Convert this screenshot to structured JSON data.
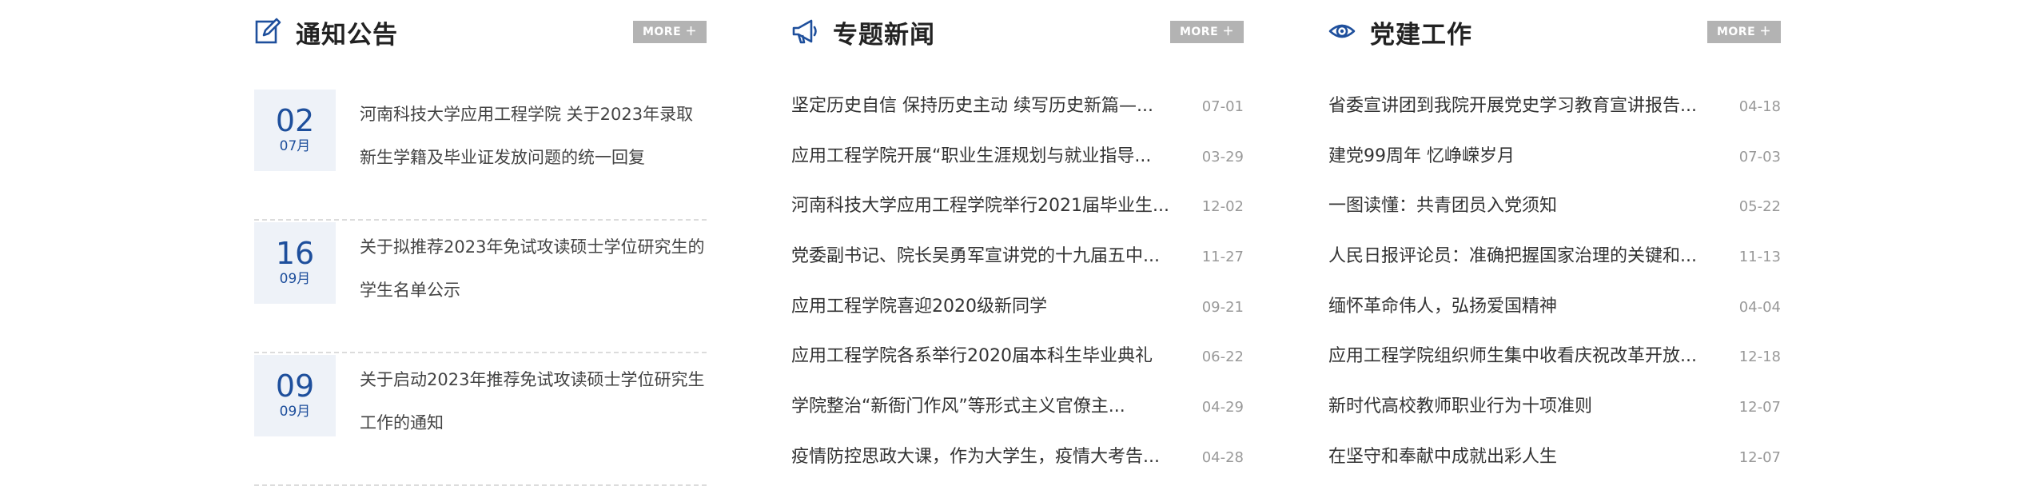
{
  "accent_color": "#1e4f9c",
  "more_bg_color": "#b3b3b3",
  "notices": {
    "title": "通知公告",
    "icon": "edit-icon",
    "more_label": "MORE ＋",
    "items": [
      {
        "day": "02",
        "month": "07月",
        "title": "河南科技大学应用工程学院 关于2023年录取新生学籍及毕业证发放问题的统一回复"
      },
      {
        "day": "16",
        "month": "09月",
        "title": "关于拟推荐2023年免试攻读硕士学位研究生的学生名单公示"
      },
      {
        "day": "09",
        "month": "09月",
        "title": "关于启动2023年推荐免试攻读硕士学位研究生工作的通知"
      }
    ]
  },
  "news": {
    "title": "专题新闻",
    "icon": "megaphone-icon",
    "more_label": "MORE ＋",
    "items": [
      {
        "title": "坚定历史自信 保持历史主动 续写历史新篇—...",
        "date": "07-01"
      },
      {
        "title": "应用工程学院开展“职业生涯规划与就业指导...",
        "date": "03-29"
      },
      {
        "title": "河南科技大学应用工程学院举行2021届毕业生...",
        "date": "12-02"
      },
      {
        "title": "党委副书记、院长吴勇军宣讲党的十九届五中...",
        "date": "11-27"
      },
      {
        "title": "应用工程学院喜迎2020级新同学",
        "date": "09-21"
      },
      {
        "title": "应用工程学院各系举行2020届本科生毕业典礼",
        "date": "06-22"
      },
      {
        "title": "学院整治“新衙门作风”等形式主义官僚主...",
        "date": "04-29"
      },
      {
        "title": "疫情防控思政大课，作为大学生，疫情大考告...",
        "date": "04-28"
      }
    ]
  },
  "party": {
    "title": "党建工作",
    "icon": "eye-icon",
    "more_label": "MORE ＋",
    "items": [
      {
        "title": "省委宣讲团到我院开展党史学习教育宣讲报告...",
        "date": "04-18"
      },
      {
        "title": "建党99周年 忆峥嵘岁月",
        "date": "07-03"
      },
      {
        "title": "一图读懂：共青团员入党须知",
        "date": "05-22"
      },
      {
        "title": "人民日报评论员：准确把握国家治理的关键和...",
        "date": "11-13"
      },
      {
        "title": "缅怀革命伟人，弘扬爱国精神",
        "date": "04-04"
      },
      {
        "title": "应用工程学院组织师生集中收看庆祝改革开放...",
        "date": "12-18"
      },
      {
        "title": "新时代高校教师职业行为十项准则",
        "date": "12-07"
      },
      {
        "title": "在坚守和奉献中成就出彩人生",
        "date": "12-07"
      }
    ]
  }
}
